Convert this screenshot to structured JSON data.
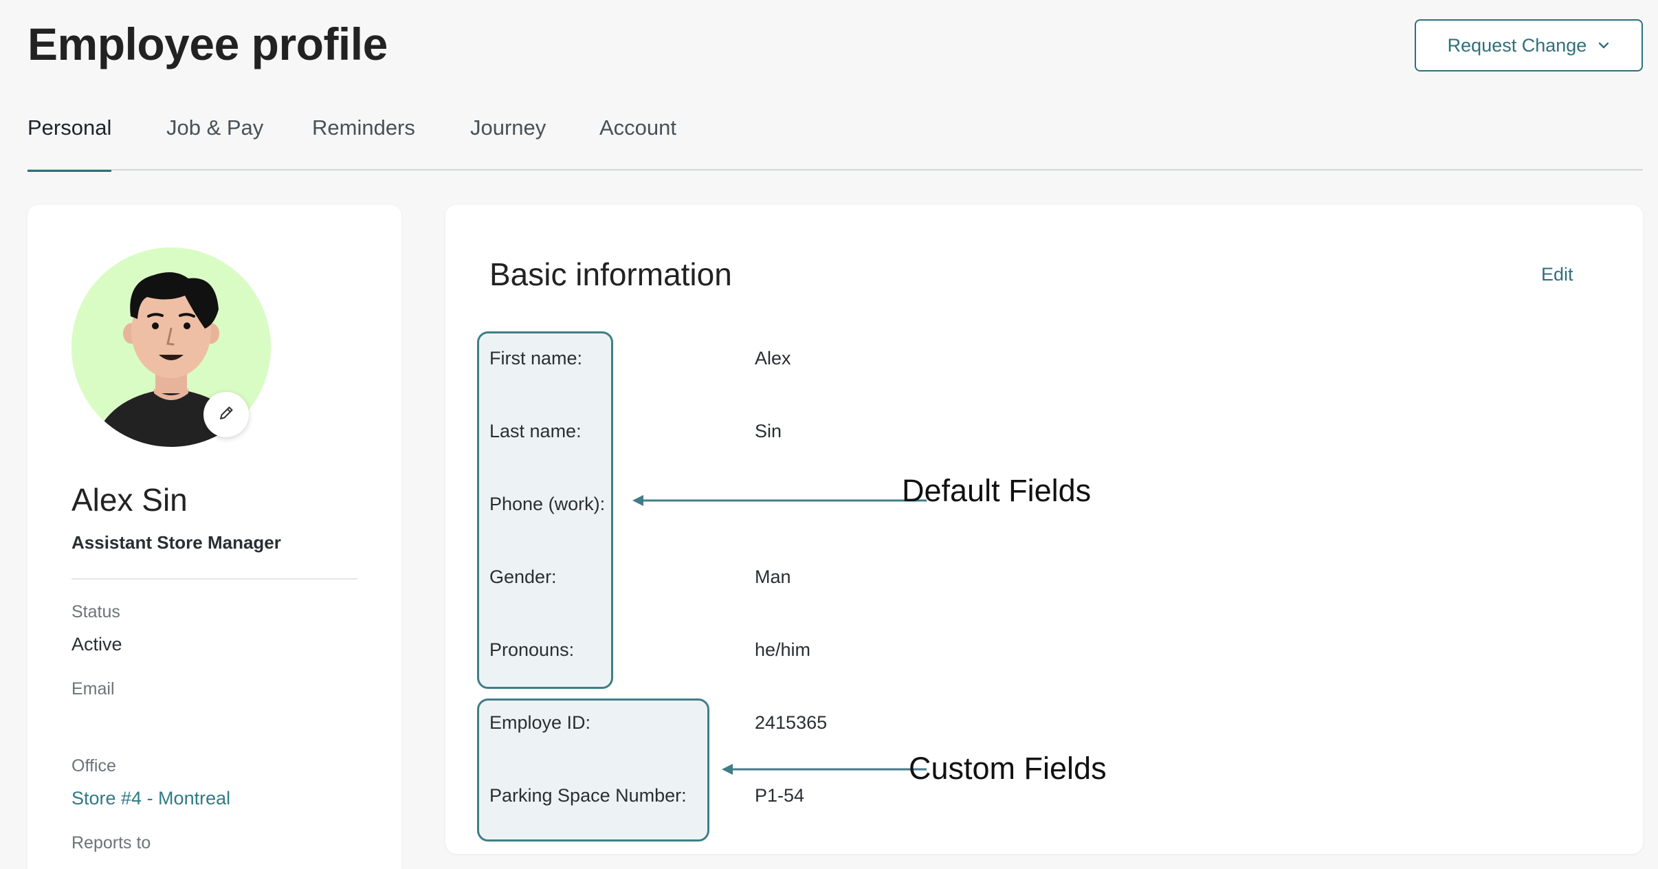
{
  "header": {
    "title": "Employee profile",
    "request_button": "Request Change"
  },
  "tabs": [
    {
      "label": "Personal",
      "active": true
    },
    {
      "label": "Job & Pay",
      "active": false
    },
    {
      "label": "Reminders",
      "active": false
    },
    {
      "label": "Journey",
      "active": false
    },
    {
      "label": "Account",
      "active": false
    }
  ],
  "profile": {
    "name": "Alex Sin",
    "job_title": "Assistant Store Manager",
    "status_label": "Status",
    "status_value": "Active",
    "email_label": "Email",
    "office_label": "Office",
    "office_value": "Store #4 - Montreal",
    "reports_to_label": "Reports to"
  },
  "basic_info": {
    "title": "Basic information",
    "edit_label": "Edit",
    "default_fields": [
      {
        "label": "First name:",
        "value": "Alex"
      },
      {
        "label": "Last name:",
        "value": "Sin"
      },
      {
        "label": "Phone (work):",
        "value": ""
      },
      {
        "label": "Gender:",
        "value": "Man"
      },
      {
        "label": "Pronouns:",
        "value": "he/him"
      }
    ],
    "custom_fields": [
      {
        "label": "Employe ID:",
        "value": "2415365"
      },
      {
        "label": "Parking Space Number:",
        "value": "P1-54"
      }
    ]
  },
  "annotations": {
    "default_fields": "Default Fields",
    "custom_fields": "Custom Fields"
  },
  "colors": {
    "accent": "#2f6f7a",
    "group_border": "#3f7d88",
    "group_fill": "#edf3f5",
    "avatar_bg": "#d9fcc4"
  },
  "icons": {
    "request_chevron": "chevron-down-icon",
    "avatar_edit": "pencil-icon"
  }
}
